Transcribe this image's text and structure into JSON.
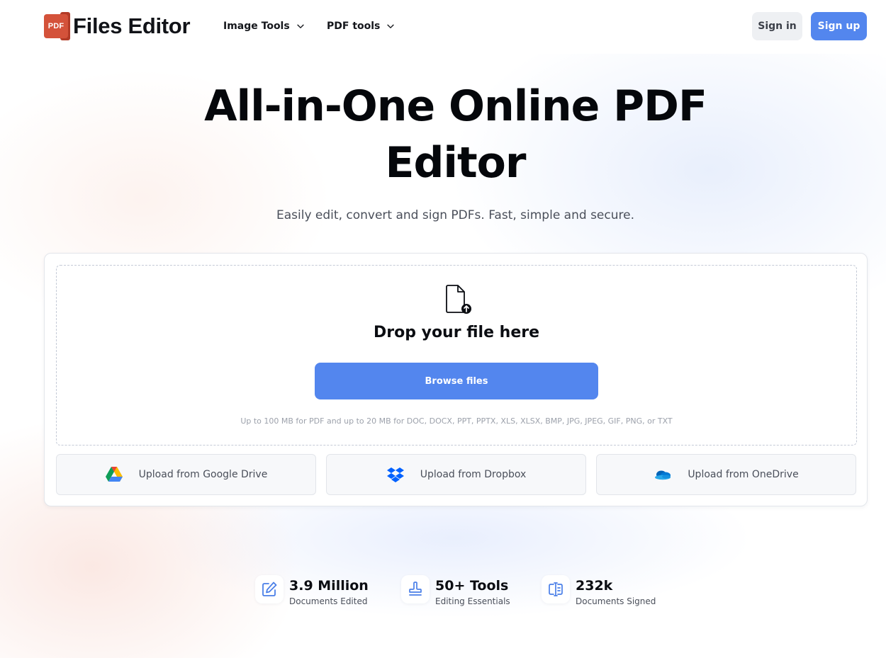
{
  "brand": {
    "logo_mark": "PDF",
    "name": "Files Editor"
  },
  "nav": {
    "items": [
      {
        "label": "Image Tools",
        "icon": "chevron-down-icon"
      },
      {
        "label": "PDF tools",
        "icon": "chevron-down-icon"
      }
    ],
    "sign_in": "Sign in",
    "sign_up": "Sign up"
  },
  "colors": {
    "accent": "#5386ee",
    "brand_red": "#d4523a"
  },
  "hero": {
    "title_line1": "All-in-One Online PDF",
    "title_line2": "Editor",
    "subtitle": "Easily edit, convert and sign PDFs. Fast, simple and secure."
  },
  "upload": {
    "icon": "file-upload-icon",
    "drop_title": "Drop your file here",
    "browse_label": "Browse files",
    "limits": "Up to 100 MB for PDF and up to 20 MB for DOC, DOCX, PPT, PPTX, XLS, XLSX, BMP, JPG, JPEG, GIF, PNG, or TXT",
    "sources": [
      {
        "label": "Upload from Google Drive",
        "icon": "google-drive-icon"
      },
      {
        "label": "Upload from Dropbox",
        "icon": "dropbox-icon"
      },
      {
        "label": "Upload from OneDrive",
        "icon": "onedrive-icon"
      }
    ]
  },
  "stats": [
    {
      "value": "3.9 Million",
      "label": "Documents Edited",
      "icon": "edit-icon"
    },
    {
      "value": "50+ Tools",
      "label": "Editing Essentials",
      "icon": "stamp-icon"
    },
    {
      "value": "232k",
      "label": "Documents Signed",
      "icon": "sign-icon"
    }
  ]
}
